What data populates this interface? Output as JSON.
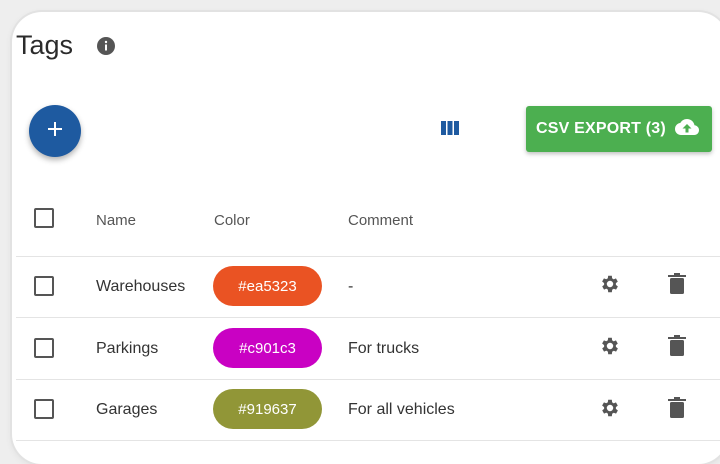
{
  "page": {
    "title": "Tags"
  },
  "toolbar": {
    "add_icon": "plus-icon",
    "columns_icon": "view-columns-icon",
    "export_label": "CSV EXPORT (3)",
    "export_icon": "cloud-upload-icon",
    "export_color": "#4caf50",
    "fab_color": "#1e5aa0"
  },
  "table": {
    "headers": [
      "Name",
      "Color",
      "Comment"
    ],
    "rows": [
      {
        "name": "Warehouses",
        "color_label": "#ea5323",
        "color": "#ea5323",
        "comment": "-"
      },
      {
        "name": "Parkings",
        "color_label": "#c901c3",
        "color": "#c901c3",
        "comment": "For trucks"
      },
      {
        "name": "Garages",
        "color_label": "#919637",
        "color": "#919637",
        "comment": "For all vehicles"
      }
    ],
    "row_actions": [
      "gear-icon",
      "trash-icon"
    ]
  }
}
